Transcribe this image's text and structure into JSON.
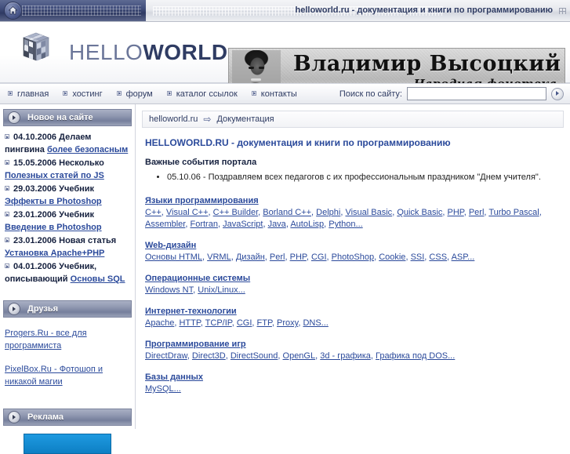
{
  "topbar": {
    "home_icon": "home-icon",
    "title": "helloworld.ru - документация и книги по программированию"
  },
  "header": {
    "logo": {
      "part1": "HELLO",
      "part2": "WORLD",
      "icon": "rubiks-cube-logo"
    },
    "banner": {
      "title": "Владимир Высоцкий",
      "subtitle": "Народная фонотека"
    }
  },
  "nav": {
    "items": [
      {
        "label": "главная"
      },
      {
        "label": "хостинг"
      },
      {
        "label": "форум"
      },
      {
        "label": "каталог ссылок"
      },
      {
        "label": "контакты"
      }
    ],
    "search": {
      "label": "Поиск по сайту:",
      "value": "",
      "placeholder": "",
      "go_icon": "arrow-right-icon"
    }
  },
  "sidebar": {
    "blocks": [
      {
        "title": "Новое на сайте",
        "news": [
          {
            "date": "04.10.2006",
            "text": "Делаем пингвина",
            "link": "более безопасным"
          },
          {
            "date": "15.05.2006",
            "text": "Несколько",
            "link": "Полезных статей по JS"
          },
          {
            "date": "29.03.2006",
            "text": "Учебник",
            "link": "Эффекты в Photoshop"
          },
          {
            "date": "23.01.2006",
            "text": "Учебник",
            "link": "Введение в Photoshop"
          },
          {
            "date": "23.01.2006",
            "text": "Новая статья",
            "link": "Установка Apache+PHP"
          },
          {
            "date": "04.01.2006",
            "text": "Учебник, описывающий",
            "link": "Основы SQL"
          }
        ]
      },
      {
        "title": "Друзья",
        "friends": [
          {
            "label": "Progers.Ru - все для программиста"
          },
          {
            "label": "PixelBox.Ru - Фотошоп и никакой магии"
          }
        ]
      },
      {
        "title": "Реклама",
        "ad": true
      }
    ]
  },
  "main": {
    "breadcrumb": {
      "root": "helloworld.ru",
      "arrow": "⇨",
      "current": "Документация"
    },
    "page_title": "HELLOWORLD.RU - документация и книги по программированию",
    "events_title": "Важные события портала",
    "events": [
      "05.10.06 - Поздравляем всех педагогов с их профессиональным праздником \"Днем учителя\"."
    ],
    "categories": [
      {
        "title": "Языки программирования",
        "links": [
          "C++",
          "Visual C++",
          "C++ Builder",
          "Borland C++",
          "Delphi",
          "Visual Basic",
          "Quick Basic",
          "PHP",
          "Perl",
          "Turbo Pascal",
          "Assembler",
          "Fortran",
          "JavaScript",
          "Java",
          "AutoLisp",
          "Python..."
        ]
      },
      {
        "title": "Web-дизайн",
        "links": [
          "Основы HTML",
          "VRML",
          "Дизайн",
          "Perl",
          "PHP",
          "CGI",
          "PhotoShop",
          "Cookie",
          "SSI",
          "CSS",
          "ASP..."
        ]
      },
      {
        "title": "Операционные системы",
        "links": [
          "Windows NT",
          "Unix/Linux..."
        ]
      },
      {
        "title": "Интернет-технологии",
        "links": [
          "Apache",
          "HTTP",
          "TCP/IP",
          "CGI",
          "FTP",
          "Proxy",
          "DNS..."
        ]
      },
      {
        "title": "Программирование игр",
        "links": [
          "DirectDraw",
          "Direct3D",
          "DirectSound",
          "OpenGL",
          "3d - графика",
          "Графика под DOS..."
        ]
      },
      {
        "title": "Базы данных",
        "links": [
          "MySQL..."
        ]
      }
    ]
  },
  "colors": {
    "link": "#2b4a9b",
    "topbar_dark": "#2f3a63",
    "header_blue": "#2f3c63"
  }
}
